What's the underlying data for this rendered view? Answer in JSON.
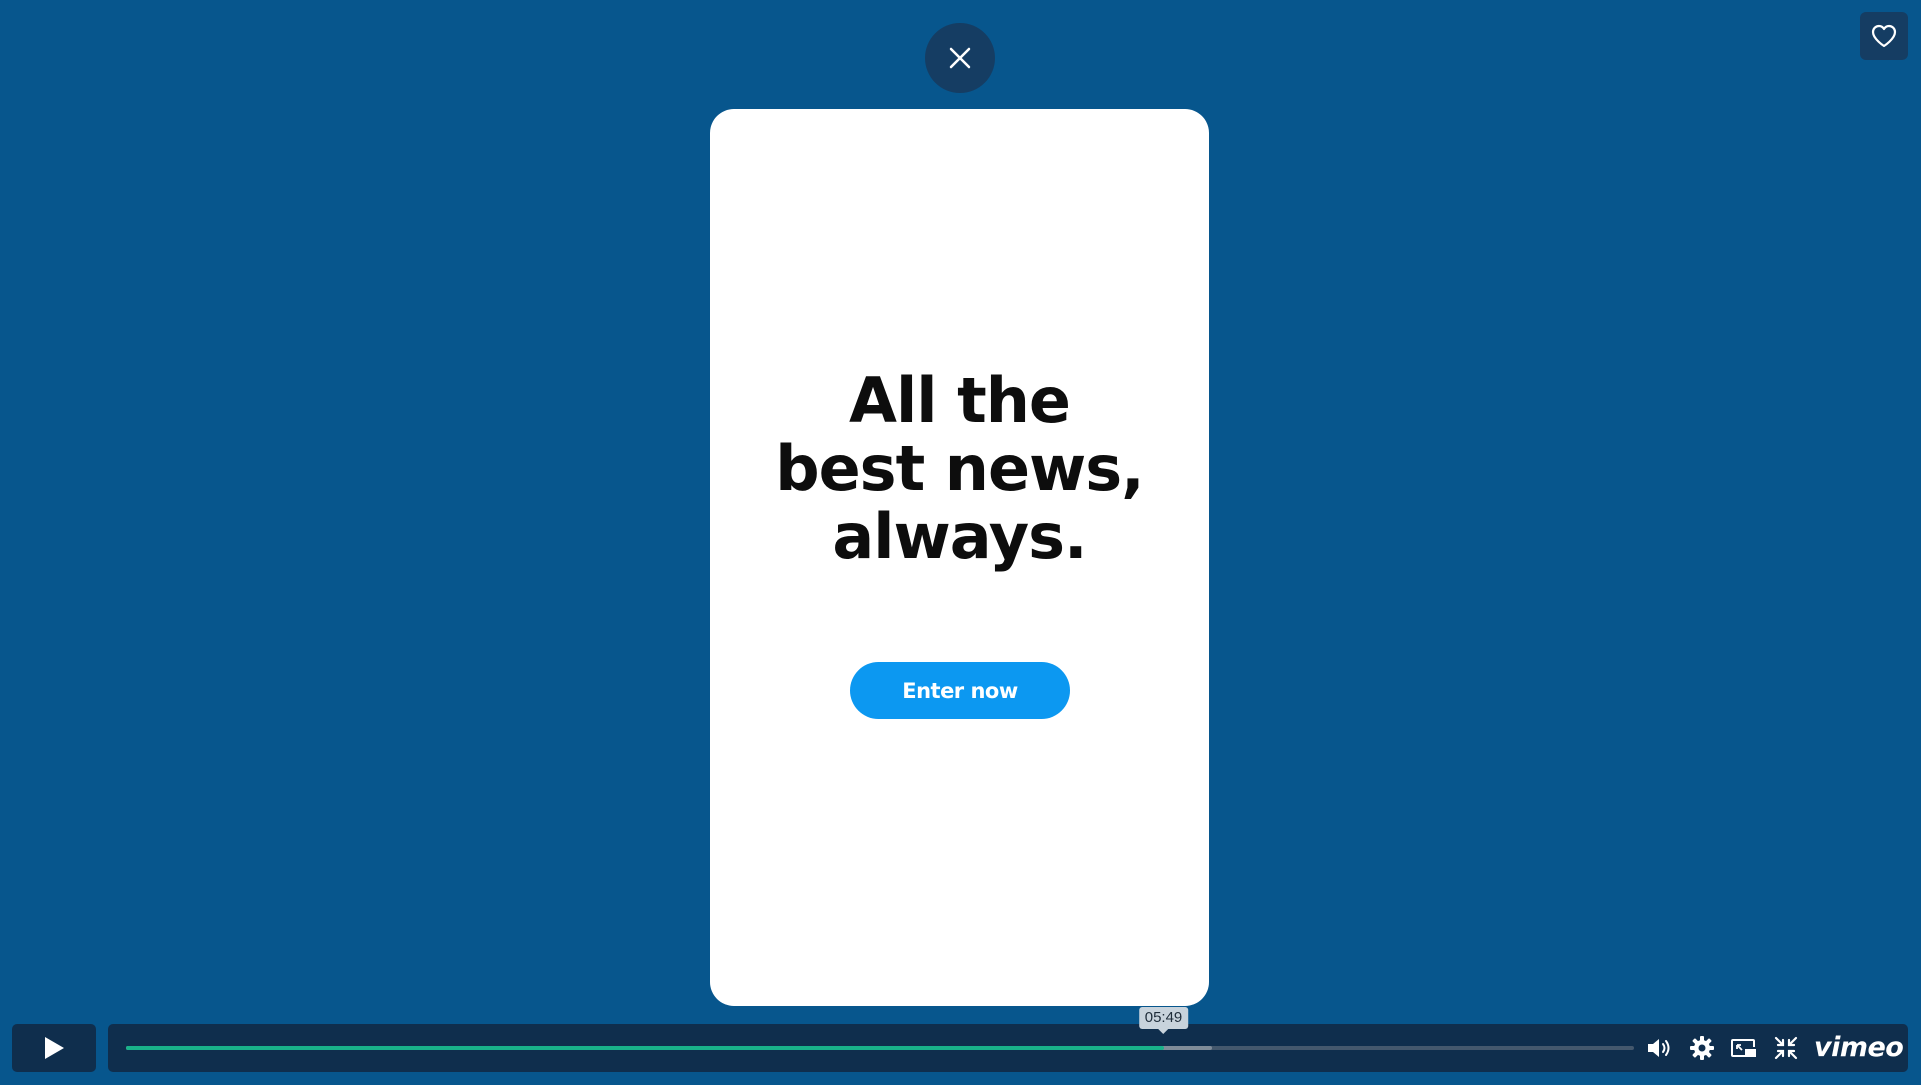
{
  "modal": {
    "headline_lines": [
      "All the",
      "best news,",
      "always."
    ],
    "cta_label": "Enter now",
    "close_icon": "close-icon"
  },
  "player": {
    "like_icon": "heart-icon",
    "play_icon": "play-icon",
    "progress_played_fraction": 0.688,
    "progress_buffered_fraction": 0.72,
    "hover_time": "05:49",
    "controls": [
      "volume-icon",
      "settings-icon",
      "picture-in-picture-icon",
      "exit-fullscreen-icon"
    ],
    "brand": "vimeo"
  },
  "colors": {
    "background": "#07568d",
    "card": "#ffffff",
    "cta": "#0c98f1",
    "controls_bg": "#0f2e4d",
    "progress_played": "#19b28a"
  }
}
